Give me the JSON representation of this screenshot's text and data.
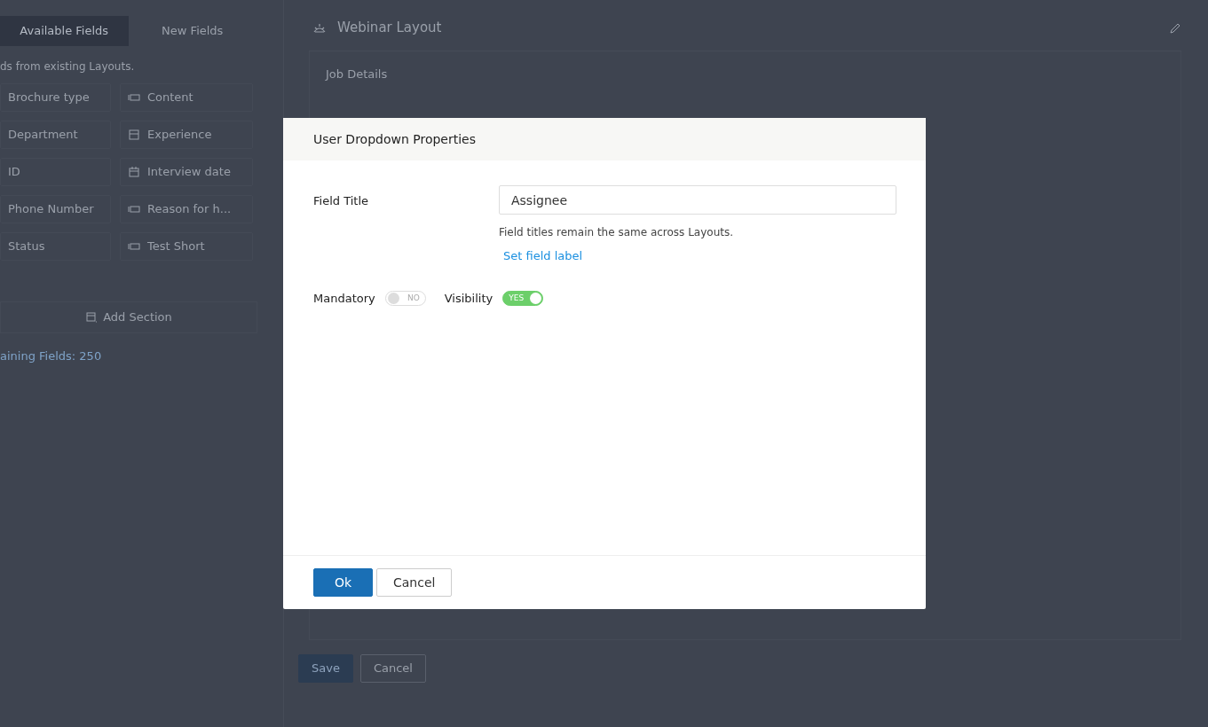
{
  "fields_panel": {
    "tabs": [
      {
        "label": "Available Fields",
        "selected": true
      },
      {
        "label": "New Fields",
        "selected": false
      }
    ],
    "hint": "ds from existing Layouts.",
    "fields": [
      {
        "label": "Brochure type",
        "kind": "plain"
      },
      {
        "label": "Content",
        "kind": "text"
      },
      {
        "label": "Department",
        "kind": "plain"
      },
      {
        "label": "Experience",
        "kind": "multiline"
      },
      {
        "label": "ID",
        "kind": "plain"
      },
      {
        "label": "Interview date",
        "kind": "date"
      },
      {
        "label": "Phone Number",
        "kind": "plain"
      },
      {
        "label": "Reason for h...",
        "kind": "text"
      },
      {
        "label": "Status",
        "kind": "plain"
      },
      {
        "label": "Test Short",
        "kind": "text"
      }
    ],
    "add_section": "Add Section",
    "remaining": "aining Fields: 250"
  },
  "layout": {
    "title": "Webinar Layout",
    "section": "Job Details",
    "buttons": [
      {
        "label": "Save",
        "kind": "primary"
      },
      {
        "label": "Cancel",
        "kind": "secondary"
      }
    ]
  },
  "modal": {
    "title": "User Dropdown Properties",
    "field_label": "Field Title",
    "value": "Assignee",
    "help": "Field titles remain the same across Layouts.",
    "link": "Set field label",
    "toggles": [
      {
        "label": "Mandatory",
        "on": false,
        "text": "NO"
      },
      {
        "label": "Visibility",
        "on": true,
        "text": "YES"
      }
    ],
    "buttons": [
      {
        "label": "Ok",
        "kind": "primary"
      },
      {
        "label": "Cancel",
        "kind": "secondary"
      }
    ]
  }
}
